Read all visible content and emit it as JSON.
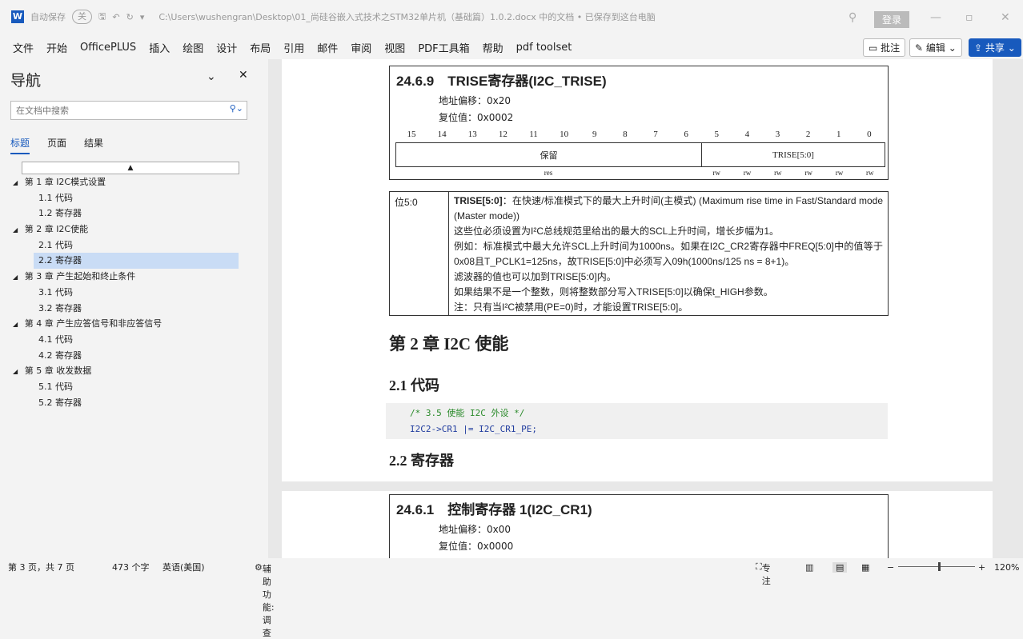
{
  "titlebar": {
    "autosave": "自动保存",
    "toggle": "关",
    "title": "C:\\Users\\wushengran\\Desktop\\01_尚硅谷嵌入式技术之STM32单片机（基础篇）1.0.2.docx 中的文档 • 已保存到这台电脑",
    "login": "登录"
  },
  "ribbon": {
    "tabs": [
      "文件",
      "开始",
      "OfficePLUS",
      "插入",
      "绘图",
      "设计",
      "布局",
      "引用",
      "邮件",
      "审阅",
      "视图",
      "PDF工具箱",
      "帮助",
      "pdf toolset"
    ],
    "comment": "批注",
    "edit": "编辑",
    "share": "共享"
  },
  "nav": {
    "title": "导航",
    "search_placeholder": "在文档中搜索",
    "tabs": [
      "标题",
      "页面",
      "结果"
    ],
    "items": [
      {
        "label": "第 1 章 I2C模式设置",
        "level": 1
      },
      {
        "label": "1.1 代码",
        "level": 2
      },
      {
        "label": "1.2 寄存器",
        "level": 2
      },
      {
        "label": "第 2 章 I2C使能",
        "level": 1
      },
      {
        "label": "2.1 代码",
        "level": 2
      },
      {
        "label": "2.2 寄存器",
        "level": 2,
        "selected": true
      },
      {
        "label": "第 3 章 产生起始和终止条件",
        "level": 1
      },
      {
        "label": "3.1 代码",
        "level": 2
      },
      {
        "label": "3.2 寄存器",
        "level": 2
      },
      {
        "label": "第 4 章 产生应答信号和非应答信号",
        "level": 1
      },
      {
        "label": "4.1 代码",
        "level": 2
      },
      {
        "label": "4.2 寄存器",
        "level": 2
      },
      {
        "label": "第 5 章 收发数据",
        "level": 1
      },
      {
        "label": "5.1 代码",
        "level": 2
      },
      {
        "label": "5.2 寄存器",
        "level": 2
      }
    ]
  },
  "doc": {
    "trise": {
      "title": "24.6.9　TRISE寄存器(I2C_TRISE)",
      "offset": "地址偏移：0x20",
      "reset": "复位值：0x0002",
      "bits": [
        "15",
        "14",
        "13",
        "12",
        "11",
        "10",
        "9",
        "8",
        "7",
        "6",
        "5",
        "4",
        "3",
        "2",
        "1",
        "0"
      ],
      "reserved": "保留",
      "field": "TRISE[5:0]",
      "res": "res",
      "rw": "rw"
    },
    "desc": {
      "bit": "位5:0",
      "name": "TRISE[5:0]",
      "lines": [
        "：在快速/标准模式下的最大上升时间(主模式) (Maximum rise time in Fast/Standard mode (Master mode))",
        "这些位必须设置为I²C总线规范里给出的最大的SCL上升时间，增长步幅为1。",
        "例如：标准模式中最大允许SCL上升时间为1000ns。如果在I2C_CR2寄存器中FREQ[5:0]中的值等于0x08且T_PCLK1=125ns，故TRISE[5:0]中必须写入09h(1000ns/125 ns = 8+1)。",
        "滤波器的值也可以加到TRISE[5:0]内。",
        "如果结果不是一个整数，则将整数部分写入TRISE[5:0]以确保t_HIGH参数。",
        "注：只有当I²C被禁用(PE=0)时，才能设置TRISE[5:0]。"
      ]
    },
    "h_ch2": "第 2 章 I2C 使能",
    "h_21": "2.1 代码",
    "code": {
      "comment": "/* 3.5 使能 I2C 外设 */",
      "line": "I2C2->CR1 |= I2C_CR1_PE;"
    },
    "h_22": "2.2 寄存器",
    "cr1": {
      "title": "24.6.1　控制寄存器 1(I2C_CR1)",
      "offset": "地址偏移：0x00",
      "reset": "复位值：0x0000"
    }
  },
  "status": {
    "page": "第 3 页，共 7 页",
    "words": "473 个字",
    "lang": "英语(美国)",
    "access": "辅助功能: 调查",
    "focus": "专注",
    "zoom": "120%"
  }
}
